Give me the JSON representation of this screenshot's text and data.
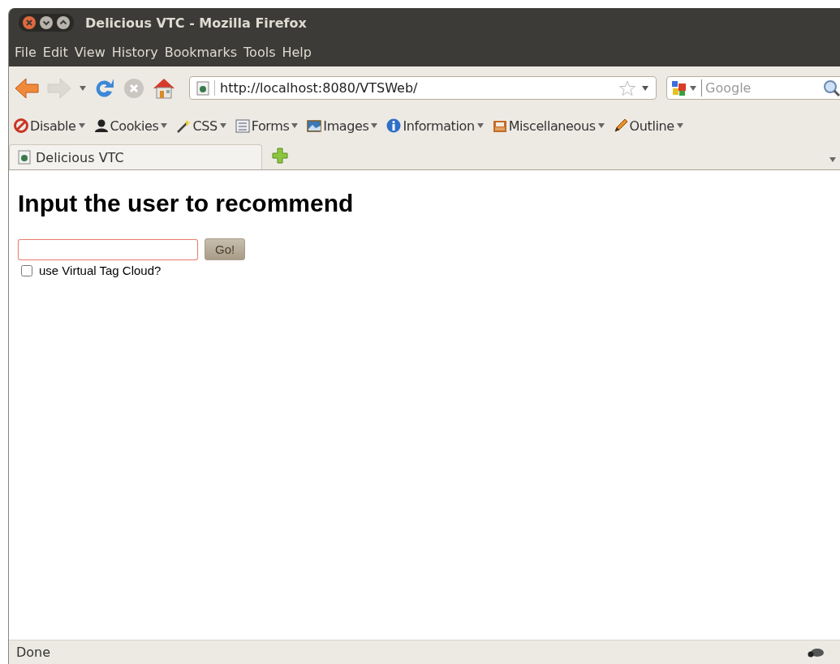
{
  "window": {
    "title": "Delicious VTC - Mozilla Firefox"
  },
  "menu_bar": [
    "File",
    "Edit",
    "View",
    "History",
    "Bookmarks",
    "Tools",
    "Help"
  ],
  "navigation": {
    "url": "http://localhost:8080/VTSWeb/",
    "search": {
      "placeholder": "Google"
    }
  },
  "dev_toolbar": [
    {
      "kind": "disable",
      "label": "Disable"
    },
    {
      "kind": "cookies",
      "label": "Cookies"
    },
    {
      "kind": "css",
      "label": "CSS"
    },
    {
      "kind": "forms",
      "label": "Forms"
    },
    {
      "kind": "images",
      "label": "Images"
    },
    {
      "kind": "information",
      "label": "Information"
    },
    {
      "kind": "misc",
      "label": "Miscellaneous"
    },
    {
      "kind": "outline",
      "label": "Outline"
    }
  ],
  "tabs": [
    {
      "label": "Delicious VTC",
      "selected": true
    }
  ],
  "page": {
    "heading": "Input the user to recommend",
    "button": "Go!",
    "checkbox": {
      "label": "use Virtual Tag Cloud?",
      "checked": false
    }
  },
  "status_bar": {
    "text": "Done"
  }
}
